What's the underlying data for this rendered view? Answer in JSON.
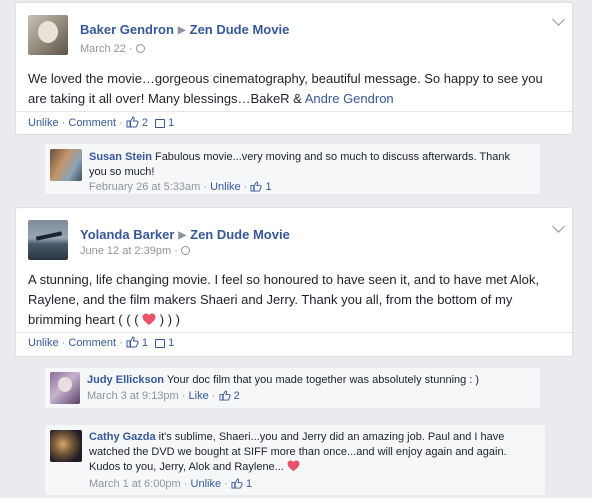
{
  "posts": [
    {
      "author": "Baker Gendron",
      "target": "Zen Dude Movie",
      "time": "March 22",
      "text": "We loved the movie…gorgeous cinematography, beautiful message. So happy to see you are taking it all over! Many blessings…BakeR &",
      "mention": "Andre Gendron",
      "actions": {
        "unlike": "Unlike",
        "comment": "Comment",
        "likes": "2",
        "comments": "1"
      }
    },
    {
      "author": "Yolanda Barker",
      "target": "Zen Dude Movie",
      "time": "June 12 at 2:39pm",
      "text": "A stunning, life changing movie. I feel so honoured to have seen it, and to have met Alok, Raylene, and the film makers Shaeri and Jerry. Thank you all, from the bottom of my brimming heart ( ( (",
      "text_end": ") ) )",
      "actions": {
        "unlike": "Unlike",
        "comment": "Comment",
        "likes": "1",
        "comments": "1"
      }
    }
  ],
  "replies": [
    {
      "author": "Susan Stein",
      "text": "Fabulous movie...very moving and so much to discuss afterwards. Thank you so much!",
      "time": "February 26 at 5:33am",
      "unlike": "Unlike",
      "likes": "1"
    },
    {
      "author": "Judy Ellickson",
      "text": "Your doc film that you made together was absolutely stunning : )",
      "time": "March 3 at 9:13pm",
      "like": "Like",
      "likes": "2"
    },
    {
      "author": "Cathy Gazda",
      "text": "it's sublime, Shaeri...you and Jerry did an amazing job. Paul and I have watched the DVD we bought at SIFF more than once...and will enjoy again and again. Kudos to you, Jerry, Alok and Raylene...",
      "time": "March 1 at 6:00pm",
      "unlike": "Unlike",
      "likes": "1"
    }
  ],
  "colors": {
    "link": "#365899",
    "heart": "#e8536c",
    "background": "#e9ebee"
  }
}
